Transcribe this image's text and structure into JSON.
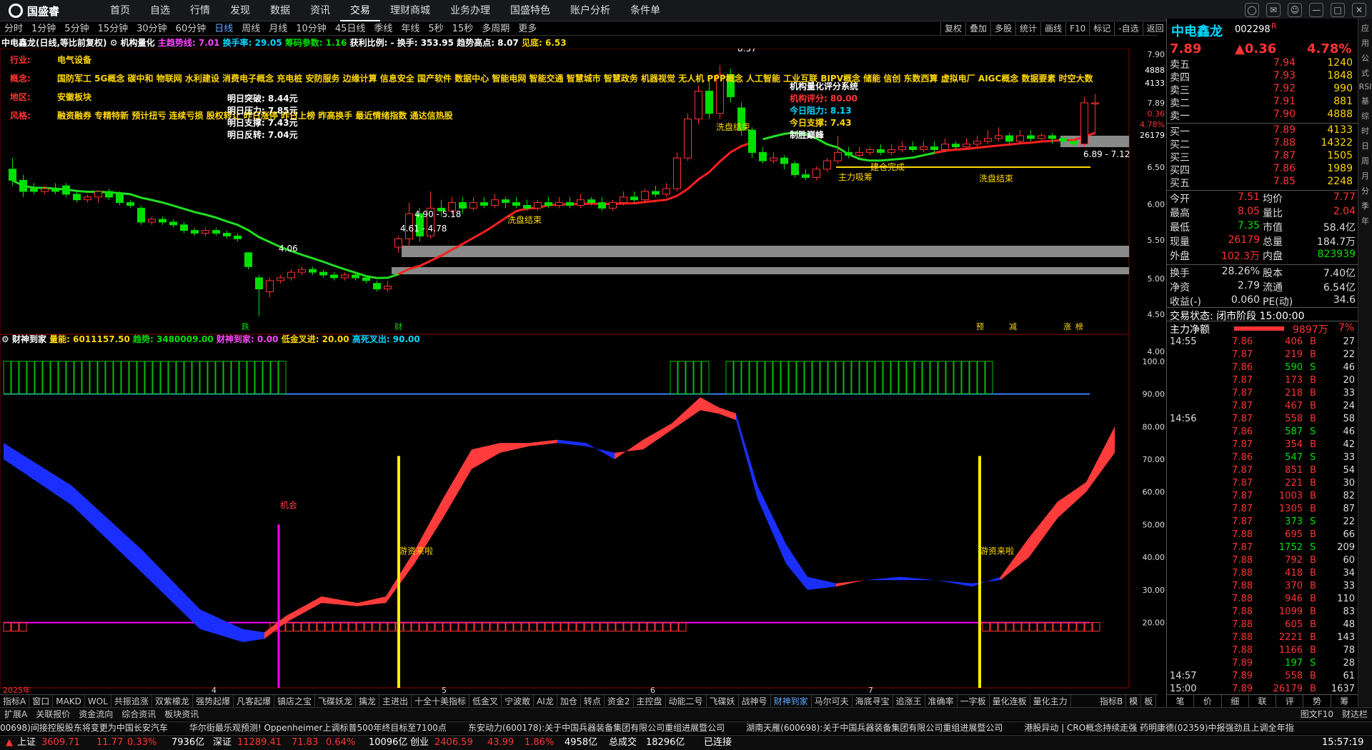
{
  "app": {
    "logo_text": "国盛睿"
  },
  "menu": [
    "首页",
    "自选",
    "行情",
    "发现",
    "数据",
    "资讯",
    "交易",
    "理财商城",
    "业务办理",
    "国盛特色",
    "账户分析",
    "条件单"
  ],
  "menu_active_index": 6,
  "window_controls": [
    "搜索",
    "消息",
    "用户",
    "最小化",
    "最大化",
    "关闭"
  ],
  "periods": [
    "分时",
    "1分钟",
    "5分钟",
    "15分钟",
    "30分钟",
    "60分钟",
    "日线",
    "周线",
    "月线",
    "10分钟",
    "45日线",
    "季线",
    "年线",
    "5秒",
    "15秒",
    "多周期",
    "更多"
  ],
  "period_active_index": 6,
  "chart_tools": [
    "复权",
    "叠加",
    "多股",
    "统计",
    "画线",
    "F10",
    "标记",
    "-自选",
    "返回"
  ],
  "info_line": {
    "stock": "中电鑫龙(日线,等比前复权)",
    "indicator": "机构量化",
    "trend_label": "主趋势线: 7.01",
    "turnover": "换手率: 29.05",
    "chip": "筹码参数: 1.16",
    "profit": "获利比例: -",
    "handoff": "换手: 353.95",
    "trend_high": "趋势高点: 8.07",
    "top": "见底: 6.53"
  },
  "profile": {
    "industry_label": "行业:",
    "industry": "电气设备",
    "concept_label": "概念:",
    "concept": "国防军工 5G概念 碳中和 物联网 水利建设 消费电子概念 充电桩 安防服务 边缘计算 信息安全 国产软件 数据中心 智能电网 智能交通 智慧城市 智慧政务 机器视觉 无人机 PPP概念 人工智能 工业互联 BIPV概念 储能 信创 东数西算 虚拟电厂 AIGC概念 数据要素 时空大数",
    "region_label": "地区:",
    "region": "安徽板块",
    "style_label": "风格:",
    "style": "融资融券 专精特新 预计扭亏 连续亏损 股权转让 昨日涨停 昨日上榜 昨高换手 最近情绪指数 通达信热股"
  },
  "tomorrow_box": [
    {
      "label": "明日突破:",
      "value": "8.44元"
    },
    {
      "label": "明日压力:",
      "value": "7.85元"
    },
    {
      "label": "明日支撑:",
      "value": "7.43元"
    },
    {
      "label": "明日反转:",
      "value": "7.04元"
    }
  ],
  "quant_box": {
    "title": "机构量化评分系统",
    "score_label": "机构评分:",
    "score": "80.00",
    "resist_label": "今日阻力:",
    "resist": "8.13",
    "support_label": "今日支撑:",
    "support": "7.43",
    "status": "制胜巅峰"
  },
  "chart_annotations": {
    "high_label": "8.57",
    "low_label": "4.06",
    "range1": "4.90 - 5.18",
    "range2": "4.61 - 4.78",
    "range3": "6.89 - 7.12",
    "wash1": "洗盘结束",
    "wash2": "洗盘结束",
    "wash3": "洗盘结束",
    "chip_build": "建仓完成",
    "main_absorb": "主力吸筹",
    "bottom_marks": [
      "跌",
      "财",
      "预",
      "减",
      "涨",
      "榜"
    ]
  },
  "price_axis": [
    "7.90",
    "4888",
    "4133",
    "7.89",
    "0.36",
    "4.78%",
    "26179",
    "6.50",
    "6.00",
    "5.50",
    "5.00",
    "4.50",
    "4.00"
  ],
  "lower_panel": {
    "title": "财神到家",
    "l1": "量能: 6011157.50",
    "l2": "趋势: 3480009.00",
    "l3": "财神到家: 0.00",
    "l4": "低金叉进: 20.00",
    "l5": "高死叉出: 90.00",
    "chance": "机会",
    "fund_in_1": "游资来啦",
    "fund_in_2": "游资来啦"
  },
  "lower_axis": [
    "100.0",
    "90.00",
    "80.00",
    "70.00",
    "60.00",
    "50.00",
    "40.00",
    "30.00",
    "20.00"
  ],
  "time_axis": [
    "2025年",
    "4",
    "5",
    "6",
    "7"
  ],
  "chart_data": {
    "type": "candlestick",
    "title": "中电鑫龙(日线,等比前复权)",
    "ylim": [
      3.8,
      8.8
    ],
    "candles": [
      [
        6.7,
        6.5,
        6.9,
        6.4
      ],
      [
        6.5,
        6.3,
        6.6,
        6.2
      ],
      [
        6.35,
        6.3,
        6.45,
        6.25
      ],
      [
        6.3,
        6.35,
        6.4,
        6.25
      ],
      [
        6.35,
        6.3,
        6.45,
        6.25
      ],
      [
        6.4,
        6.25,
        6.45,
        6.2
      ],
      [
        6.25,
        6.15,
        6.3,
        6.1
      ],
      [
        6.15,
        6.2,
        6.25,
        6.1
      ],
      [
        6.2,
        6.3,
        6.3,
        6.1
      ],
      [
        6.3,
        6.2,
        6.35,
        6.15
      ],
      [
        6.25,
        6.1,
        6.3,
        6.05
      ],
      [
        6.1,
        6.05,
        6.15,
        6.0
      ],
      [
        6.0,
        5.75,
        6.05,
        5.7
      ],
      [
        5.75,
        5.8,
        5.85,
        5.7
      ],
      [
        5.8,
        5.75,
        5.85,
        5.7
      ],
      [
        5.75,
        5.7,
        5.8,
        5.65
      ],
      [
        5.7,
        5.6,
        5.75,
        5.55
      ],
      [
        5.6,
        5.55,
        5.65,
        5.5
      ],
      [
        5.55,
        5.6,
        5.65,
        5.5
      ],
      [
        5.6,
        5.55,
        5.65,
        5.5
      ],
      [
        5.55,
        5.5,
        5.6,
        5.45
      ],
      [
        5.5,
        5.45,
        5.55,
        5.4
      ],
      [
        5.2,
        4.95,
        5.2,
        4.9
      ],
      [
        4.75,
        4.55,
        4.8,
        4.06
      ],
      [
        4.5,
        4.7,
        4.75,
        4.4
      ],
      [
        4.7,
        4.75,
        4.8,
        4.65
      ],
      [
        4.75,
        4.85,
        4.9,
        4.7
      ],
      [
        4.85,
        4.9,
        4.95,
        4.8
      ],
      [
        4.9,
        4.85,
        4.95,
        4.8
      ],
      [
        4.85,
        4.8,
        4.9,
        4.75
      ],
      [
        4.8,
        4.75,
        4.85,
        4.7
      ],
      [
        4.75,
        4.8,
        4.85,
        4.7
      ],
      [
        4.8,
        4.75,
        4.85,
        4.7
      ],
      [
        4.75,
        4.7,
        4.8,
        4.65
      ],
      [
        4.65,
        4.55,
        4.7,
        4.5
      ],
      [
        4.55,
        4.6,
        4.7,
        4.5
      ],
      [
        5.3,
        5.45,
        5.5,
        5.2
      ],
      [
        5.45,
        5.9,
        6.1,
        5.3
      ],
      [
        5.9,
        5.5,
        6.0,
        5.4
      ],
      [
        5.5,
        6.0,
        6.3,
        5.45
      ],
      [
        6.0,
        5.95,
        6.15,
        5.85
      ],
      [
        5.95,
        6.1,
        6.2,
        5.9
      ],
      [
        6.1,
        6.0,
        6.2,
        5.9
      ],
      [
        6.0,
        6.1,
        6.2,
        5.95
      ],
      [
        6.1,
        6.05,
        6.2,
        6.0
      ],
      [
        6.05,
        6.15,
        6.25,
        6.0
      ],
      [
        6.15,
        6.1,
        6.2,
        6.0
      ],
      [
        6.1,
        6.05,
        6.2,
        6.0
      ],
      [
        6.05,
        6.0,
        6.15,
        5.95
      ],
      [
        6.0,
        6.1,
        6.15,
        5.95
      ],
      [
        6.1,
        6.05,
        6.2,
        6.0
      ],
      [
        6.05,
        6.1,
        6.2,
        6.0
      ],
      [
        6.1,
        6.05,
        6.2,
        6.0
      ],
      [
        6.05,
        6.15,
        6.25,
        6.0
      ],
      [
        6.15,
        6.1,
        6.2,
        6.05
      ],
      [
        6.1,
        6.0,
        6.2,
        5.95
      ],
      [
        6.0,
        6.1,
        6.15,
        5.95
      ],
      [
        6.1,
        6.2,
        6.3,
        6.05
      ],
      [
        6.2,
        6.15,
        6.3,
        6.1
      ],
      [
        6.15,
        6.3,
        6.35,
        6.1
      ],
      [
        6.3,
        6.25,
        6.4,
        6.2
      ],
      [
        6.25,
        6.35,
        6.45,
        6.2
      ],
      [
        6.35,
        6.9,
        7.0,
        6.3
      ],
      [
        6.9,
        7.6,
        7.7,
        6.85
      ],
      [
        7.6,
        8.1,
        8.2,
        7.5
      ],
      [
        8.1,
        7.7,
        8.3,
        7.6
      ],
      [
        7.7,
        8.4,
        8.57,
        7.6
      ],
      [
        8.4,
        8.0,
        8.5,
        7.9
      ],
      [
        7.8,
        7.4,
        7.9,
        7.3
      ],
      [
        7.4,
        7.0,
        7.45,
        6.9
      ],
      [
        7.0,
        6.85,
        7.1,
        6.8
      ],
      [
        6.85,
        6.9,
        7.0,
        6.8
      ],
      [
        6.9,
        6.8,
        6.95,
        6.7
      ],
      [
        6.8,
        6.6,
        6.85,
        6.55
      ],
      [
        6.6,
        6.55,
        6.7,
        6.5
      ],
      [
        6.55,
        6.7,
        6.75,
        6.5
      ],
      [
        6.7,
        6.85,
        6.9,
        6.65
      ],
      [
        6.85,
        7.0,
        7.3,
        6.8
      ],
      [
        7.0,
        6.95,
        7.1,
        6.9
      ],
      [
        6.95,
        7.0,
        7.1,
        6.9
      ],
      [
        7.0,
        7.05,
        7.1,
        6.95
      ],
      [
        7.05,
        7.0,
        7.15,
        6.95
      ],
      [
        7.0,
        7.05,
        7.15,
        6.95
      ],
      [
        7.05,
        7.1,
        7.2,
        7.0
      ],
      [
        7.1,
        7.05,
        7.2,
        7.0
      ],
      [
        7.05,
        7.1,
        7.2,
        7.0
      ],
      [
        7.1,
        7.05,
        7.2,
        7.0
      ],
      [
        7.05,
        7.15,
        7.25,
        7.0
      ],
      [
        7.15,
        7.1,
        7.2,
        7.05
      ],
      [
        7.1,
        7.15,
        7.25,
        7.05
      ],
      [
        7.15,
        7.2,
        7.3,
        7.1
      ],
      [
        7.2,
        7.25,
        7.4,
        7.15
      ],
      [
        7.25,
        7.3,
        7.45,
        7.2
      ],
      [
        7.3,
        7.2,
        7.35,
        7.15
      ],
      [
        7.2,
        7.3,
        7.4,
        7.15
      ],
      [
        7.3,
        7.25,
        7.4,
        7.2
      ],
      [
        7.25,
        7.3,
        7.35,
        7.2
      ],
      [
        7.3,
        7.25,
        7.35,
        7.15
      ],
      [
        7.25,
        7.2,
        7.3,
        7.1
      ],
      [
        7.2,
        7.15,
        7.25,
        7.1
      ],
      [
        7.15,
        7.89,
        8.0,
        7.1
      ],
      [
        7.89,
        7.89,
        8.05,
        7.35
      ]
    ],
    "ma_green_last": 7.01,
    "lower_ylim": [
      0,
      105
    ]
  },
  "right": {
    "name": "中电鑫龙",
    "code": "002298",
    "flag": "R",
    "price": "7.89",
    "change": "▲0.36",
    "pct": "4.78%",
    "sell": [
      [
        "卖五",
        "7.94",
        "1240"
      ],
      [
        "卖四",
        "7.93",
        "1848"
      ],
      [
        "卖三",
        "7.92",
        "990"
      ],
      [
        "卖二",
        "7.91",
        "881"
      ],
      [
        "卖一",
        "7.90",
        "4888"
      ]
    ],
    "buy": [
      [
        "买一",
        "7.89",
        "4133"
      ],
      [
        "买二",
        "7.88",
        "14322"
      ],
      [
        "买三",
        "7.87",
        "1505"
      ],
      [
        "买四",
        "7.86",
        "1989"
      ],
      [
        "买五",
        "7.85",
        "2248"
      ]
    ],
    "stats": [
      [
        "今开",
        "7.51",
        "均价",
        "7.77"
      ],
      [
        "最高",
        "8.05",
        "量比",
        "2.04"
      ],
      [
        "最低",
        "7.35",
        "市值",
        "58.4亿"
      ],
      [
        "现量",
        "26179",
        "总量",
        "184.7万"
      ],
      [
        "外盘",
        "102.3万",
        "内盘",
        "823939"
      ],
      [
        "换手",
        "28.26%",
        "股本",
        "7.40亿"
      ],
      [
        "净资",
        "2.79",
        "流通",
        "6.54亿"
      ],
      [
        "收益(-)",
        "0.060",
        "PE(动)",
        "34.6"
      ]
    ],
    "trade_status": "交易状态: 闭市阶段 15:00:00",
    "main_net_label": "主力净额",
    "main_net_value": "9897万",
    "main_net_pct": "7%",
    "ticks": [
      [
        "14:55",
        "7.86",
        "406",
        "B",
        "27"
      ],
      [
        "",
        "7.87",
        "219",
        "B",
        "22"
      ],
      [
        "",
        "7.86",
        "590",
        "S",
        "46"
      ],
      [
        "",
        "7.87",
        "173",
        "B",
        "20"
      ],
      [
        "",
        "7.87",
        "218",
        "B",
        "33"
      ],
      [
        "",
        "7.87",
        "467",
        "B",
        "24"
      ],
      [
        "14:56",
        "7.87",
        "558",
        "B",
        "58"
      ],
      [
        "",
        "7.86",
        "587",
        "S",
        "46"
      ],
      [
        "",
        "7.87",
        "354",
        "B",
        "42"
      ],
      [
        "",
        "7.86",
        "547",
        "S",
        "33"
      ],
      [
        "",
        "7.87",
        "851",
        "B",
        "54"
      ],
      [
        "",
        "7.87",
        "221",
        "B",
        "30"
      ],
      [
        "",
        "7.87",
        "1003",
        "B",
        "82"
      ],
      [
        "",
        "7.87",
        "1305",
        "B",
        "87"
      ],
      [
        "",
        "7.87",
        "373",
        "S",
        "22"
      ],
      [
        "",
        "7.88",
        "695",
        "B",
        "66"
      ],
      [
        "",
        "7.87",
        "1752",
        "S",
        "209"
      ],
      [
        "",
        "7.88",
        "792",
        "B",
        "60"
      ],
      [
        "",
        "7.88",
        "418",
        "B",
        "34"
      ],
      [
        "",
        "7.88",
        "370",
        "B",
        "33"
      ],
      [
        "",
        "7.88",
        "946",
        "B",
        "110"
      ],
      [
        "",
        "7.88",
        "1099",
        "B",
        "83"
      ],
      [
        "",
        "7.88",
        "605",
        "B",
        "48"
      ],
      [
        "",
        "7.88",
        "2221",
        "B",
        "143"
      ],
      [
        "",
        "7.88",
        "1166",
        "B",
        "78"
      ],
      [
        "",
        "7.89",
        "197",
        "S",
        "28"
      ],
      [
        "14:57",
        "7.89",
        "558",
        "B",
        "61"
      ],
      [
        "15:00",
        "7.89",
        "26179",
        "B",
        "1637"
      ]
    ],
    "bottom_tabs": [
      "笔",
      "价",
      "细",
      "联",
      "评",
      "势",
      "筹"
    ]
  },
  "indicator_tabs": [
    "指标A",
    "窗口",
    "MAKD",
    "WOL",
    "共振追涨",
    "双紫檬龙",
    "强势起爆",
    "凡客起爆",
    "镇店之宝",
    "飞碟妖龙",
    "擒龙",
    "主进出",
    "十全十美指标",
    "低金叉",
    "宁波敢",
    "AI龙",
    "加仓",
    "转点",
    "资金2",
    "主控盘",
    "动能二号",
    "飞碟妖",
    "战神号",
    "财神到家",
    "马尔可夫",
    "海底寻宝",
    "追涨王",
    "准确率",
    "一字板",
    "量化连板",
    "量化主力"
  ],
  "indicator_active_index": 23,
  "indicator_right": [
    "指标B",
    "模",
    "板"
  ],
  "sub_tabs": [
    "扩展A",
    "关联报价",
    "资金流向",
    "综合资讯",
    "板块资讯"
  ],
  "sub_right": [
    "图文F10",
    "财达栏"
  ],
  "news": [
    "00698)间接控股股东将变更为中国长安汽车",
    "华尔街最乐观预测! Oppenheimer上调标普500年终目标至7100点",
    "东安动力(600178):关于中国兵器装备集团有限公司重组进展暨公司",
    "湖南天雁(600698):关于中国兵器装备集团有限公司重组进展暨公司",
    "港股异动 | CRO概念持续走强 药明康德(02359)中报强劲且上调全年指"
  ],
  "status": {
    "sh_label": "上证",
    "sh_val": "3609.71",
    "sh_chg": "11.77",
    "sh_pct": "0.33%",
    "sh_amt": "7936亿",
    "sz_label": "深证",
    "sz_val": "11289.41",
    "sz_chg": "71.83",
    "sz_pct": "0.64%",
    "sz_amt": "10096亿",
    "cy_label": "创业",
    "cy_val": "2406.59",
    "cy_chg": "43.99",
    "cy_pct": "1.86%",
    "cy_amt": "4958亿",
    "total_label": "总成交",
    "total": "18296亿",
    "conn": "已连接",
    "time": "15:57:19"
  },
  "vtoolbar": [
    "应",
    "用",
    "公",
    "式",
    "RSI",
    "基",
    "综",
    "时",
    "日",
    "周",
    "月",
    "分",
    "季",
    "年"
  ],
  "colors": {
    "up": "#ff3333",
    "down": "#00e000",
    "ma_green": "#22dd22",
    "ma_red": "#ff2020",
    "yellow": "#ffd800",
    "blue": "#2244ff",
    "magenta": "#ff00ff"
  }
}
